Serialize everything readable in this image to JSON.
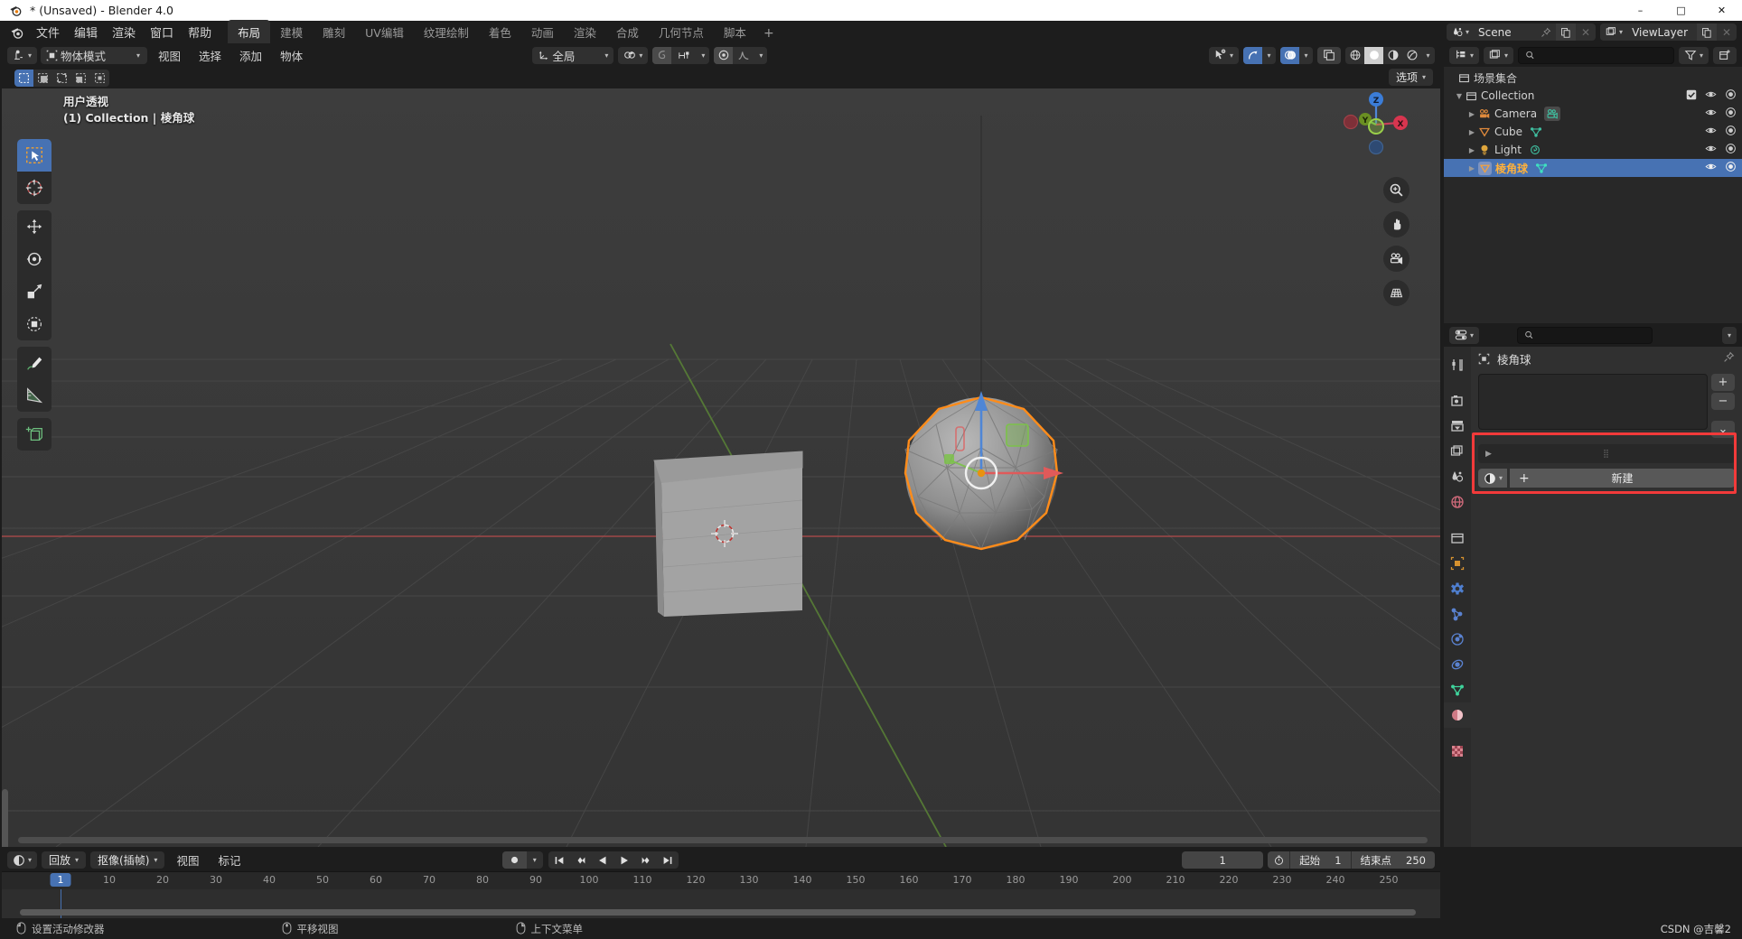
{
  "window": {
    "title": "* (Unsaved) - Blender 4.0",
    "minimize": "–",
    "maximize": "□",
    "close": "✕"
  },
  "topbar": {
    "menus": [
      "文件",
      "编辑",
      "渲染",
      "窗口",
      "帮助"
    ],
    "workspace_tabs": [
      {
        "label": "布局",
        "active": true
      },
      {
        "label": "建模",
        "active": false
      },
      {
        "label": "雕刻",
        "active": false
      },
      {
        "label": "UV编辑",
        "active": false
      },
      {
        "label": "纹理绘制",
        "active": false
      },
      {
        "label": "着色",
        "active": false
      },
      {
        "label": "动画",
        "active": false
      },
      {
        "label": "渲染",
        "active": false
      },
      {
        "label": "合成",
        "active": false
      },
      {
        "label": "几何节点",
        "active": false
      },
      {
        "label": "脚本",
        "active": false
      }
    ],
    "add_tab": "+",
    "scene": {
      "name": "Scene",
      "icon": "scene-icon"
    },
    "viewlayer": {
      "name": "ViewLayer",
      "icon": "viewlayer-icon"
    }
  },
  "viewport": {
    "editor_type_icon": "editor-type-icon",
    "mode": "物体模式",
    "menus": [
      "视图",
      "选择",
      "添加",
      "物体"
    ],
    "transform_orientation": "全局",
    "options_label": "选项",
    "overlay_line1": "用户透视",
    "overlay_line2": "(1) Collection | 棱角球",
    "select_modes": [
      "tweak-select-icon",
      "box-select-icon",
      "circle-select-icon",
      "lasso-select-icon",
      "select-all-icon"
    ],
    "tools": [
      {
        "name": "tweak-tool",
        "active": true
      },
      {
        "name": "cursor-tool",
        "active": false
      },
      {
        "name": "move-tool",
        "active": false
      },
      {
        "name": "rotate-tool",
        "active": false
      },
      {
        "name": "scale-tool",
        "active": false
      },
      {
        "name": "transform-tool",
        "active": false
      },
      {
        "name": "annotate-tool",
        "active": false
      },
      {
        "name": "measure-tool",
        "active": false
      },
      {
        "name": "add-cube-tool",
        "active": false
      }
    ],
    "gizmo_axes": {
      "x": "X",
      "y": "Y",
      "z": "Z"
    },
    "nav_buttons": [
      "zoom-icon",
      "pan-icon",
      "camera-view-icon",
      "ortho-persp-icon"
    ],
    "objects": [
      {
        "name": "Cube",
        "selected": false
      },
      {
        "name": "棱角球",
        "selected": true
      }
    ]
  },
  "outliner": {
    "display_mode_icon": "outliner-display-mode-icon",
    "filter_icon": "filter-icon",
    "new_collection_icon": "new-collection-icon",
    "search_placeholder": "",
    "search_value": "",
    "scene_collection": "场景集合",
    "rows": [
      {
        "label": "Collection",
        "indent": 1,
        "icon": "collection-icon",
        "selected": false,
        "expand": "▼",
        "checkbox": true,
        "eye": true,
        "camera": true,
        "datachip": null
      },
      {
        "label": "Camera",
        "indent": 2,
        "icon": "camera-object-icon",
        "selected": false,
        "expand": "▶",
        "checkbox": false,
        "eye": true,
        "camera": true,
        "datachip": "camera-data-icon"
      },
      {
        "label": "Cube",
        "indent": 2,
        "icon": "mesh-object-icon",
        "selected": false,
        "expand": "▶",
        "checkbox": false,
        "eye": true,
        "camera": true,
        "datachip": "mesh-data-icon"
      },
      {
        "label": "Light",
        "indent": 2,
        "icon": "light-object-icon",
        "selected": false,
        "expand": "▶",
        "checkbox": false,
        "eye": true,
        "camera": true,
        "datachip": "light-data-icon"
      },
      {
        "label": "棱角球",
        "indent": 2,
        "icon": "mesh-object-icon",
        "selected": true,
        "expand": "▶",
        "checkbox": false,
        "eye": true,
        "camera": true,
        "datachip": "mesh-data-icon"
      }
    ]
  },
  "properties": {
    "editor_type_icon": "properties-editor-icon",
    "search_placeholder": "",
    "search_value": "",
    "breadcrumb_object": "棱角球",
    "tabs": [
      {
        "name": "tool-tab",
        "active": false
      },
      {
        "name": "render-tab",
        "active": false
      },
      {
        "name": "output-tab",
        "active": false
      },
      {
        "name": "view-layer-tab",
        "active": false
      },
      {
        "name": "scene-tab",
        "active": false
      },
      {
        "name": "world-tab",
        "active": false
      },
      {
        "name": "collection-tab",
        "active": false
      },
      {
        "name": "object-tab",
        "active": false
      },
      {
        "name": "modifier-tab",
        "active": false
      },
      {
        "name": "particles-tab",
        "active": false
      },
      {
        "name": "physics-tab",
        "active": false
      },
      {
        "name": "constraints-tab",
        "active": false
      },
      {
        "name": "data-tab",
        "active": false
      },
      {
        "name": "material-tab",
        "active": true
      },
      {
        "name": "texture-tab",
        "active": false
      }
    ],
    "list_add": "+",
    "list_remove": "−",
    "list_menu": "⌄",
    "new_material_label": "新建",
    "new_material_plus": "+",
    "highlight_color": "#f23a3a"
  },
  "timeline": {
    "editor_icon": "timeline-editor-icon",
    "playback_label": "回放",
    "keying_label": "抠像(插帧)",
    "menus": [
      "视图",
      "标记"
    ],
    "transport": [
      "jump-to-start-icon",
      "jump-prev-keyframe-icon",
      "play-reverse-icon",
      "play-icon",
      "jump-next-keyframe-icon",
      "jump-to-end-icon"
    ],
    "current_frame": "1",
    "start_label": "起始",
    "start_value": "1",
    "end_label": "结束点",
    "end_value": "250",
    "ruler_ticks": [
      "10",
      "20",
      "30",
      "40",
      "50",
      "60",
      "70",
      "80",
      "90",
      "100",
      "110",
      "120",
      "130",
      "140",
      "150",
      "160",
      "170",
      "180",
      "190",
      "200",
      "210",
      "220",
      "230",
      "240",
      "250"
    ],
    "playhead_frame": "1"
  },
  "statusbar": {
    "items": [
      {
        "icon": "mouse-left-icon",
        "label": "设置活动修改器"
      },
      {
        "icon": "mouse-middle-icon",
        "label": "平移视图"
      },
      {
        "icon": "mouse-right-icon",
        "label": "上下文菜单"
      }
    ],
    "watermark": "CSDN @吉馨2"
  },
  "colors": {
    "accent_blue": "#4772b3",
    "selection_orange": "#ff8c1a",
    "highlight_red": "#f23a3a",
    "panel_bg": "#303030",
    "editor_bg": "#1d1d1d",
    "viewport_bg": "#393939"
  }
}
